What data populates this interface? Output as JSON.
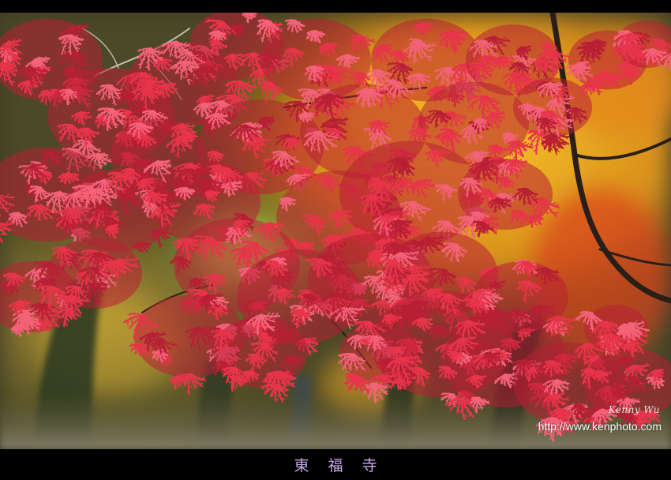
{
  "photo": {
    "subject": "red-japanese-maple-icon",
    "palette": {
      "leaf_red": "#e8344a",
      "leaf_pink": "#f4627a",
      "leaf_dark": "#b81f35",
      "background_gold": "#e0a21c",
      "background_green": "#8a9a3a",
      "trunk_dark": "#2c2a20"
    }
  },
  "watermark": {
    "signature": "Kenny Wu",
    "url": "http://www.kenphoto.com"
  },
  "caption": {
    "text": "東福寺",
    "color": "#c9a6e8"
  }
}
